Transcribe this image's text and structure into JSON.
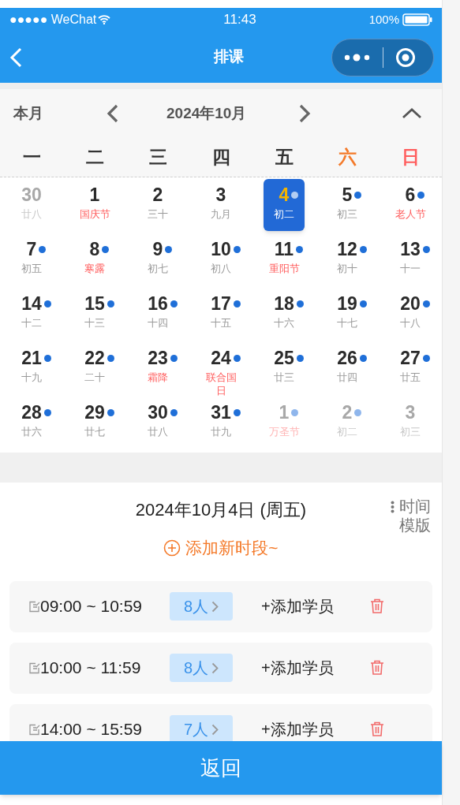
{
  "status_bar": {
    "carrier": "●●●●● WeChat",
    "time": "11:43",
    "battery": "100%"
  },
  "nav": {
    "title": "排课"
  },
  "calendar": {
    "today_button": "本月",
    "month": "2024年10月",
    "weekdays": [
      {
        "label": "一",
        "color": "#333333"
      },
      {
        "label": "二",
        "color": "#333333"
      },
      {
        "label": "三",
        "color": "#333333"
      },
      {
        "label": "四",
        "color": "#333333"
      },
      {
        "label": "五",
        "color": "#333333"
      },
      {
        "label": "六",
        "color": "#f47a2a"
      },
      {
        "label": "日",
        "color": "#ff5d5d"
      }
    ],
    "days": [
      {
        "day": "30",
        "lunar": "廿八",
        "in_month": false,
        "festival": false,
        "dot": false,
        "selected": false
      },
      {
        "day": "1",
        "lunar": "国庆节",
        "in_month": true,
        "festival": true,
        "dot": false,
        "selected": false
      },
      {
        "day": "2",
        "lunar": "三十",
        "in_month": true,
        "festival": false,
        "dot": false,
        "selected": false
      },
      {
        "day": "3",
        "lunar": "九月",
        "in_month": true,
        "festival": false,
        "dot": false,
        "selected": false
      },
      {
        "day": "4",
        "lunar": "初二",
        "in_month": true,
        "festival": false,
        "dot": true,
        "selected": true
      },
      {
        "day": "5",
        "lunar": "初三",
        "in_month": true,
        "festival": false,
        "dot": true,
        "selected": false
      },
      {
        "day": "6",
        "lunar": "老人节",
        "in_month": true,
        "festival": true,
        "dot": true,
        "selected": false
      },
      {
        "day": "7",
        "lunar": "初五",
        "in_month": true,
        "festival": false,
        "dot": true,
        "selected": false
      },
      {
        "day": "8",
        "lunar": "寒露",
        "in_month": true,
        "festival": true,
        "dot": true,
        "selected": false
      },
      {
        "day": "9",
        "lunar": "初七",
        "in_month": true,
        "festival": false,
        "dot": true,
        "selected": false
      },
      {
        "day": "10",
        "lunar": "初八",
        "in_month": true,
        "festival": false,
        "dot": true,
        "selected": false
      },
      {
        "day": "11",
        "lunar": "重阳节",
        "in_month": true,
        "festival": true,
        "dot": true,
        "selected": false
      },
      {
        "day": "12",
        "lunar": "初十",
        "in_month": true,
        "festival": false,
        "dot": true,
        "selected": false
      },
      {
        "day": "13",
        "lunar": "十一",
        "in_month": true,
        "festival": false,
        "dot": true,
        "selected": false
      },
      {
        "day": "14",
        "lunar": "十二",
        "in_month": true,
        "festival": false,
        "dot": true,
        "selected": false
      },
      {
        "day": "15",
        "lunar": "十三",
        "in_month": true,
        "festival": false,
        "dot": true,
        "selected": false
      },
      {
        "day": "16",
        "lunar": "十四",
        "in_month": true,
        "festival": false,
        "dot": true,
        "selected": false
      },
      {
        "day": "17",
        "lunar": "十五",
        "in_month": true,
        "festival": false,
        "dot": true,
        "selected": false
      },
      {
        "day": "18",
        "lunar": "十六",
        "in_month": true,
        "festival": false,
        "dot": true,
        "selected": false
      },
      {
        "day": "19",
        "lunar": "十七",
        "in_month": true,
        "festival": false,
        "dot": true,
        "selected": false
      },
      {
        "day": "20",
        "lunar": "十八",
        "in_month": true,
        "festival": false,
        "dot": true,
        "selected": false
      },
      {
        "day": "21",
        "lunar": "十九",
        "in_month": true,
        "festival": false,
        "dot": true,
        "selected": false
      },
      {
        "day": "22",
        "lunar": "二十",
        "in_month": true,
        "festival": false,
        "dot": true,
        "selected": false
      },
      {
        "day": "23",
        "lunar": "霜降",
        "in_month": true,
        "festival": true,
        "dot": true,
        "selected": false
      },
      {
        "day": "24",
        "lunar": "联合国日",
        "in_month": true,
        "festival": true,
        "dot": true,
        "selected": false
      },
      {
        "day": "25",
        "lunar": "廿三",
        "in_month": true,
        "festival": false,
        "dot": true,
        "selected": false
      },
      {
        "day": "26",
        "lunar": "廿四",
        "in_month": true,
        "festival": false,
        "dot": true,
        "selected": false
      },
      {
        "day": "27",
        "lunar": "廿五",
        "in_month": true,
        "festival": false,
        "dot": true,
        "selected": false
      },
      {
        "day": "28",
        "lunar": "廿六",
        "in_month": true,
        "festival": false,
        "dot": true,
        "selected": false
      },
      {
        "day": "29",
        "lunar": "廿七",
        "in_month": true,
        "festival": false,
        "dot": true,
        "selected": false
      },
      {
        "day": "30",
        "lunar": "廿八",
        "in_month": true,
        "festival": false,
        "dot": true,
        "selected": false
      },
      {
        "day": "31",
        "lunar": "廿九",
        "in_month": true,
        "festival": false,
        "dot": true,
        "selected": false
      },
      {
        "day": "1",
        "lunar": "万圣节",
        "in_month": false,
        "festival": true,
        "dot": true,
        "selected": false
      },
      {
        "day": "2",
        "lunar": "初二",
        "in_month": false,
        "festival": false,
        "dot": true,
        "selected": false
      },
      {
        "day": "3",
        "lunar": "初三",
        "in_month": false,
        "festival": false,
        "dot": false,
        "selected": false
      }
    ]
  },
  "schedule": {
    "date": "2024年10月4日 (周五)",
    "template_button": "时间模版",
    "add_slot": "添加新时段~",
    "slots": [
      {
        "time": "09:00 ~ 10:59",
        "count": "8人",
        "add_student": "+添加学员"
      },
      {
        "time": "10:00 ~ 11:59",
        "count": "8人",
        "add_student": "+添加学员"
      },
      {
        "time": "14:00 ~ 15:59",
        "count": "7人",
        "add_student": "+添加学员"
      }
    ]
  },
  "back_button": "返回"
}
